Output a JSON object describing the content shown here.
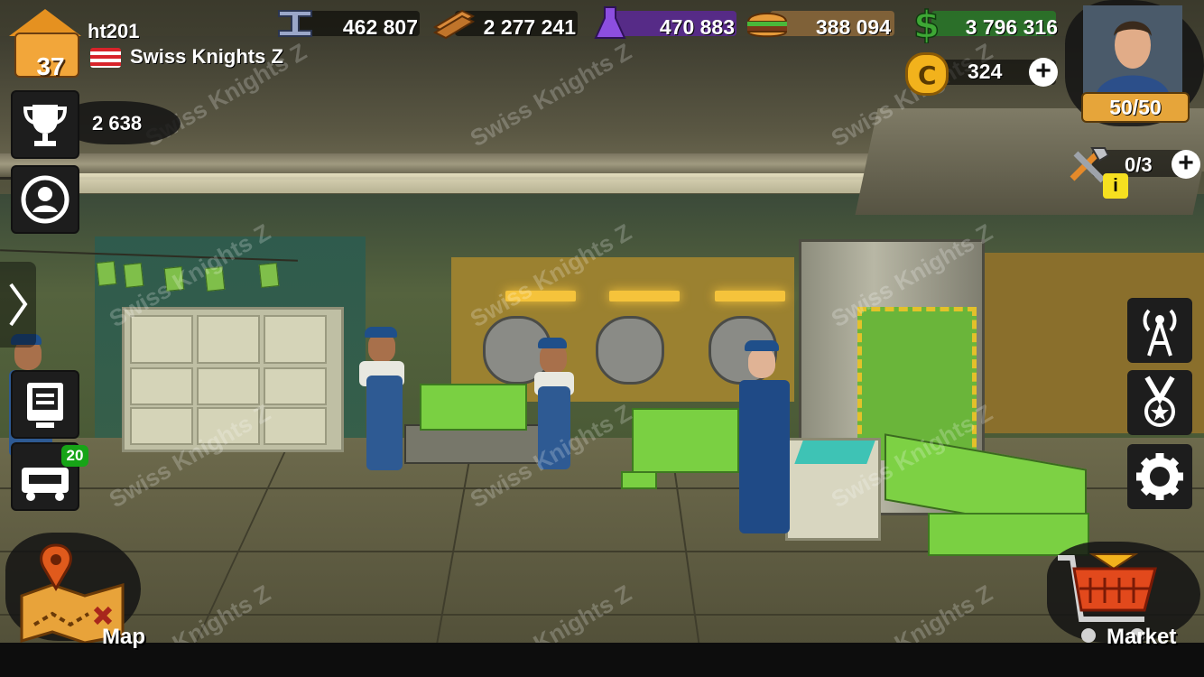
{
  "player": {
    "name": "ht201",
    "level": "37",
    "clan": "Swiss Knights Z",
    "trophies": "2 638"
  },
  "resources": {
    "steel": "462 807",
    "wood": "2 277 241",
    "science": "470 883",
    "food": "388 094",
    "cash": "3 796 316"
  },
  "gold": "324",
  "energy": "50/50",
  "builders": "0/3",
  "badges": {
    "vehicles_count": "20"
  },
  "nav": {
    "map_label": "Map",
    "market_label": "Market"
  },
  "watermark": "Swiss Knights Z",
  "icons": {
    "trophy": "trophy-icon",
    "profile": "profile-icon",
    "report": "report-icon",
    "vehicle": "vehicle-icon",
    "radio": "radio-tower-icon",
    "medal": "medal-icon",
    "settings": "gear-icon",
    "builders": "tools-icon",
    "info": "info-icon",
    "map": "map-icon",
    "market": "basket-icon"
  },
  "colors": {
    "energy_bar": "#e6a53a",
    "gold_coin": "#f2b21c",
    "badge_green": "#17a417",
    "cash_green": "#3ea735",
    "science_purple": "#7a3fc9"
  }
}
